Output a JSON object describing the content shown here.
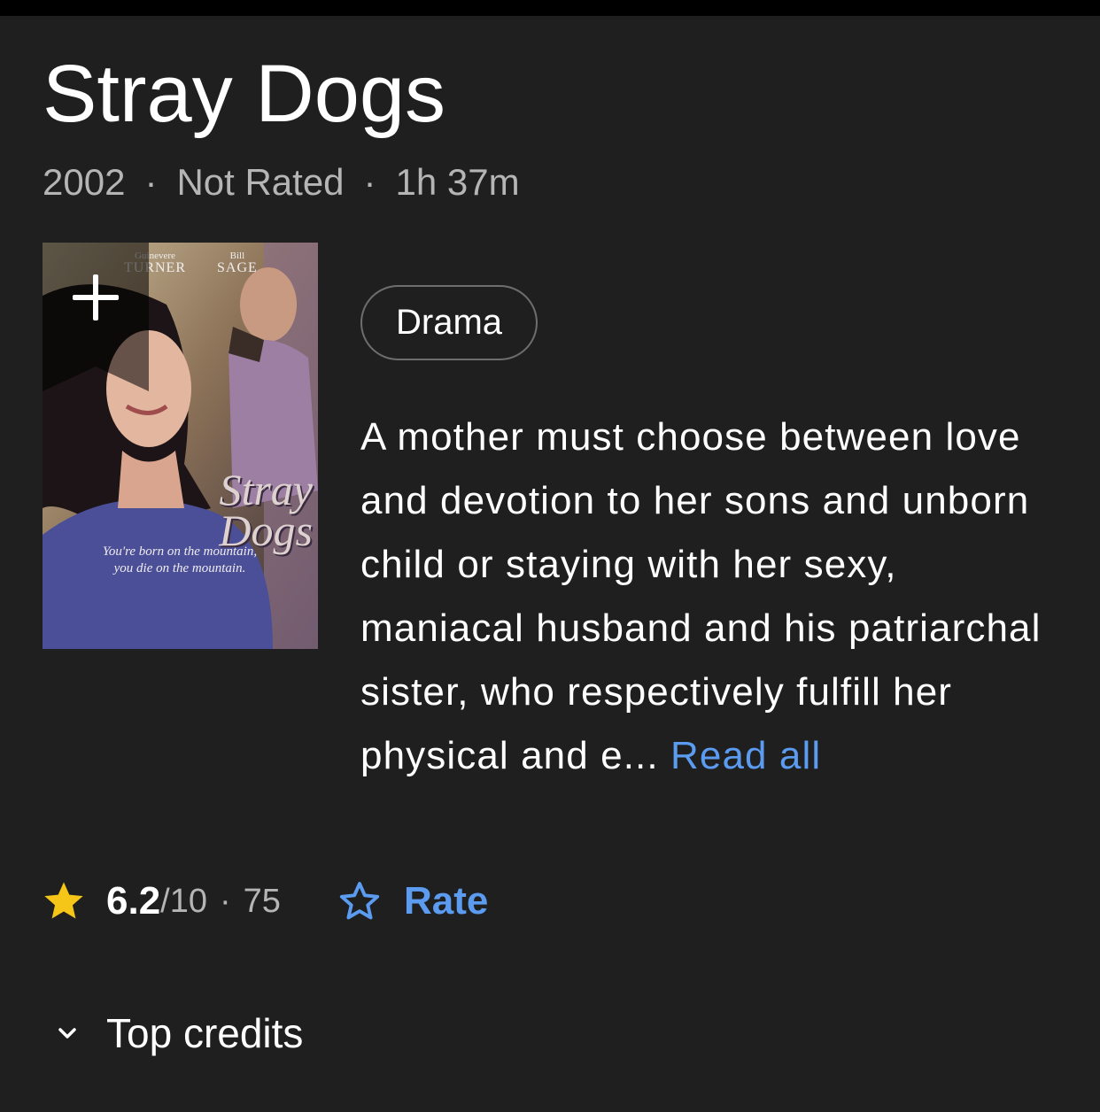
{
  "movie": {
    "title": "Stray Dogs",
    "year": "2002",
    "certificate": "Not Rated",
    "runtime": "1h 37m",
    "meta_separator": "·"
  },
  "poster": {
    "cast_1_first": "Guinevere",
    "cast_1_last": "TURNER",
    "cast_2_first": "Bill",
    "cast_2_last": "SAGE",
    "title_line1": "Stray",
    "title_line2": "Dogs",
    "tagline_line1": "You're born on the mountain,",
    "tagline_line2": "you die on the mountain."
  },
  "genres": [
    "Drama"
  ],
  "plot": {
    "text": "A mother must choose between love and devotion to her sons and unborn child or staying with her sexy, maniacal husband and his patriarchal sister, who respectively fulfill her physical and e...",
    "read_all": "Read all"
  },
  "rating": {
    "score": "6.2",
    "out_of": "/10",
    "separator": "·",
    "votes": "75",
    "star_color": "#f5c518"
  },
  "rate": {
    "label": "Rate",
    "accent_color": "#5b9bf0"
  },
  "credits": {
    "label": "Top credits",
    "icon": "chevron-down-icon"
  },
  "icons": [
    "add-to-watchlist-icon",
    "star-icon",
    "star-outline-icon",
    "chevron-down-icon"
  ]
}
